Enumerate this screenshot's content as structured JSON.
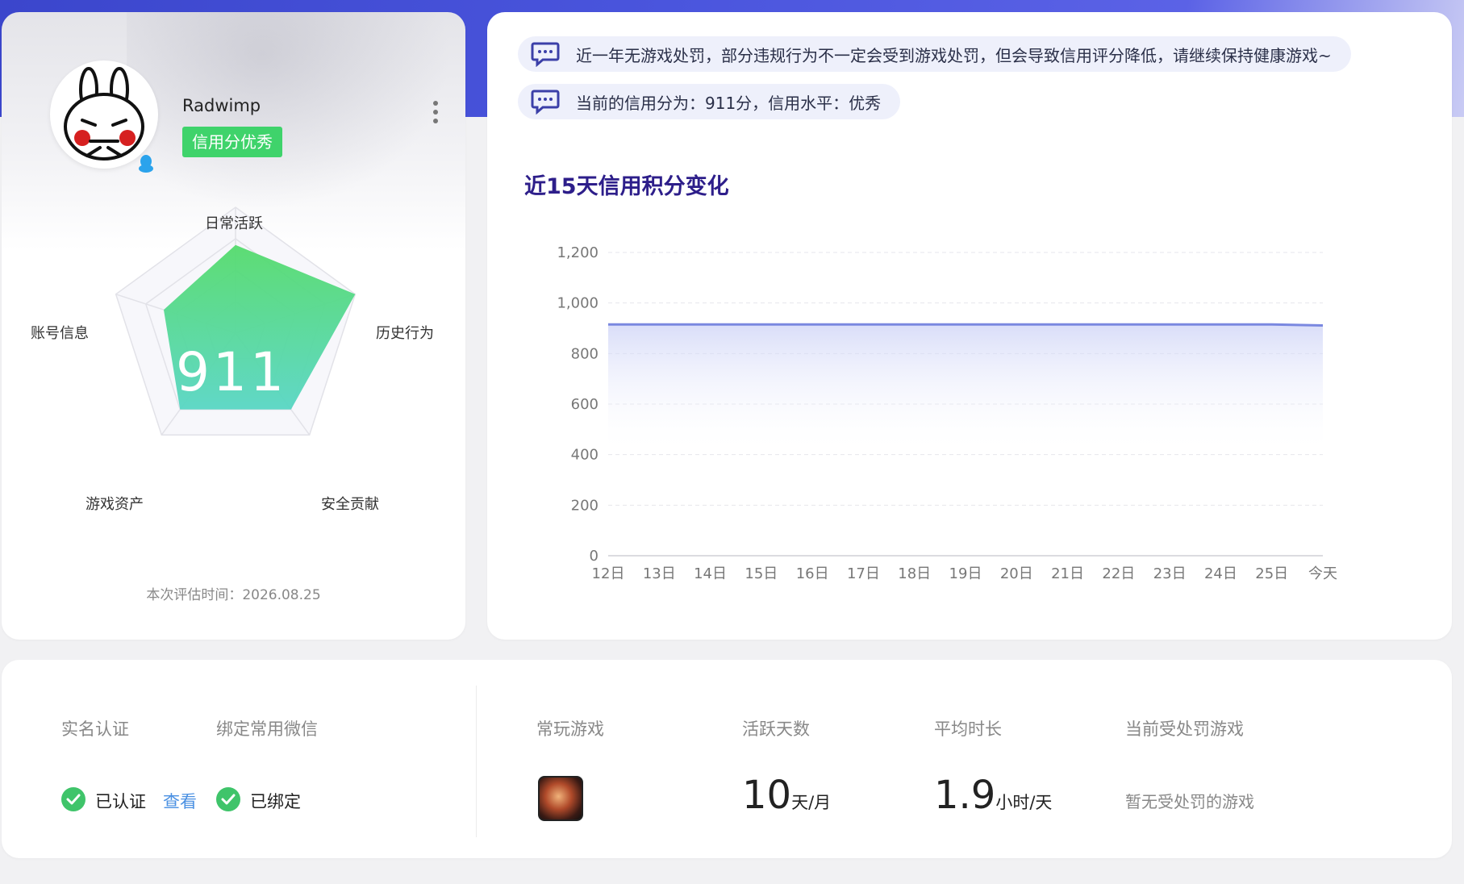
{
  "profile": {
    "username": "Radwimp",
    "credit_badge": "信用分优秀",
    "score": "911",
    "eval_time": "本次评估时间：2026.08.25",
    "radar": {
      "labels": [
        "日常活跃",
        "历史行为",
        "安全贡献",
        "游戏资产",
        "账号信息"
      ],
      "values": [
        0.7,
        1.0,
        0.75,
        0.75,
        0.6
      ]
    }
  },
  "notices": [
    "近一年无游戏处罚，部分违规行为不一定会受到游戏处罚，但会导致信用评分降低，请继续保持健康游戏~",
    "当前的信用分为：911分，信用水平：优秀"
  ],
  "chart_data": {
    "type": "area",
    "title": "近15天信用积分变化",
    "categories": [
      "12日",
      "13日",
      "14日",
      "15日",
      "16日",
      "17日",
      "18日",
      "19日",
      "20日",
      "21日",
      "22日",
      "23日",
      "24日",
      "25日",
      "今天"
    ],
    "series": [
      {
        "values": [
          915,
          915,
          915,
          915,
          915,
          915,
          915,
          915,
          915,
          915,
          915,
          915,
          915,
          915,
          911
        ]
      }
    ],
    "ylim": [
      0,
      1200
    ],
    "yticks": [
      "0",
      "200",
      "400",
      "600",
      "800",
      "1,000",
      "1,200"
    ],
    "grid": true,
    "color": "#7a88e0"
  },
  "account": {
    "realname_label": "实名认证",
    "realname_status": "已认证",
    "view_link": "查看",
    "wechat_label": "绑定常用微信",
    "wechat_status": "已绑定"
  },
  "stats": {
    "games_label": "常玩游戏",
    "active_label": "活跃天数",
    "active_value": "10",
    "active_unit": "天/月",
    "duration_label": "平均时长",
    "duration_value": "1.9",
    "duration_unit": "小时/天",
    "penalty_label": "当前受处罚游戏",
    "penalty_value": "暂无受处罚的游戏"
  },
  "colors": {
    "accent_green": "#3fd36b",
    "brand_blue": "#3b46cc",
    "link_blue": "#4a90e2"
  }
}
